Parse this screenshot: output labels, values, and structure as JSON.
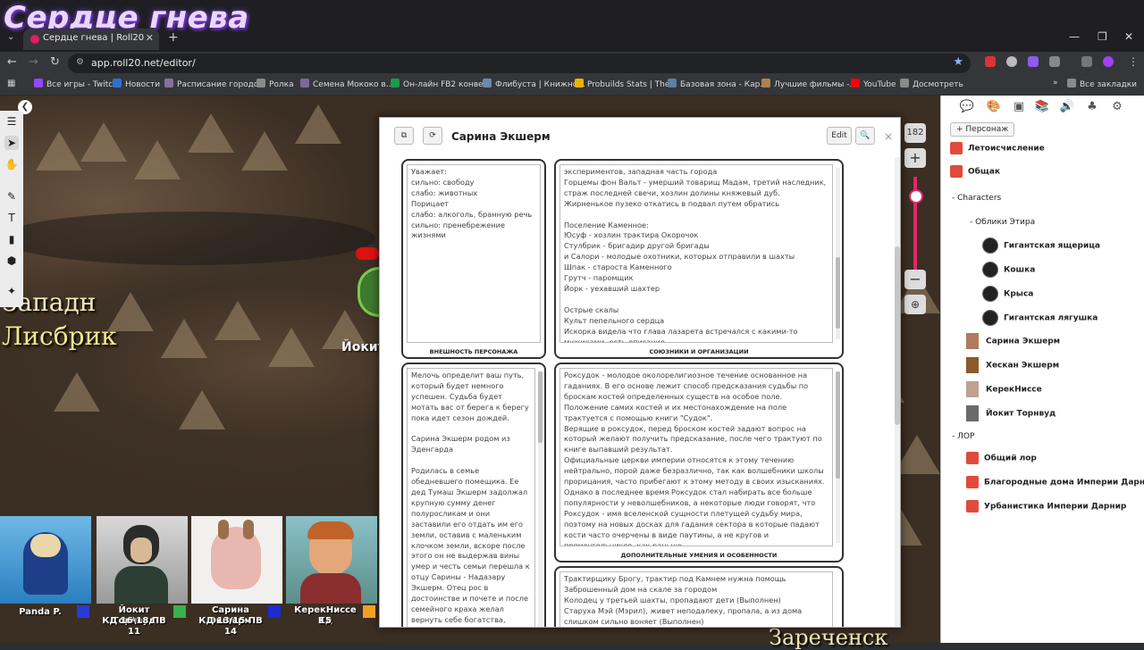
{
  "stream_title": "Сердце гнева",
  "browser": {
    "tab_title": "Сердце гнева | Roll20",
    "url": "app.roll20.net/editor/",
    "bookmarks": [
      "Все игры - Twitch",
      "Новости",
      "Расписание городс...",
      "Ролка",
      "Семена Мококо в...",
      "Он-лайн FB2 конве...",
      "Флибуста | Книжно...",
      "Probuilds Stats | The...",
      "Базовая зона - Кар...",
      "Лучшие фильмы -...",
      "YouTube",
      "Досмотреть"
    ],
    "all_bookmarks": "Все закладки",
    "more": "»"
  },
  "map": {
    "labels": [
      "Западн",
      "Лисбрик",
      "Йокит",
      "Зареченск"
    ]
  },
  "zoom": {
    "value": "182",
    "plus": "+",
    "minus": "−"
  },
  "dialog": {
    "title": "Сарина Экшерм",
    "edit": "Edit",
    "close": "×",
    "boxes": {
      "appearance": {
        "caption": "ВНЕШНОСТЬ ПЕРСОНАЖА",
        "text": "Уважает:\nсильно: свободу\nслабо: животных\nПорицает\nслабо: алкоголь, бранную речь\nсильно: пренебрежение жизнями"
      },
      "allies": {
        "caption": "СОЮЗНИКИ И ОРГАНИЗАЦИИ",
        "text": "экспериментов, западная часть города\nГорцемы фон Вальт - умерший товарищ Мадам, третий наследник, страж последней свечи, хозлин долины княжевый дуб.\nЖирненькое пузеко откатись в подвал путем обратись\n\nПоселение Каменное:\nЮсуф - хозлин трактира Окорочок\nСтулбрик - бригадир другой бригады\n и Салори - молодые охотники, которых отправили в шахты\nШпак - староста Каменного\nГрутч - паромщик\nЙорк - уехавший шахтер\n\nОстрые скалы\nКульт пепельного сердца\nИскорка видела что глава лазарета встречался с какими-то мужиками, есть описание."
      },
      "backstory": {
        "text": "Мелочь определит ваш путь, который будет немного успешен. Судьба будет мотать вас от берега к берегу пока идет сезон дождей.\n\nСарина Экшерм родом из Эденгарда\n\nРодилась в семье обедневшего помещика. Ее дед Тумаш Экшерм задолжал крупную сумму денег полуросликам и они заставили его отдать им его земли, оставив с маленьким клочком земли, вскоре после этого он не выдержав вины умер и честь семьи перешла к отцу Сарины - Надазару Экшерм. Отец рос в достоинстве и почете и после семейного краха желал вернуть себе богатства, однако имея лишь жалкий клочок земли да избу на опушке многого не"
      },
      "features": {
        "caption": "ДОПОЛНИТЕЛЬНЫЕ УМЕНИЯ И ОСОБЕННОСТИ",
        "text": "Роксудок - молодое околорелигиозное течение основанное на гаданиях. В его основе лежит способ предсказания судьбы по броскам костей определенных существ на особое поле. Положение самих костей и их местонахождение на поле трактуется с помощью книги \"Судок\".\nВерящие в роксудок, перед броском костей задают вопрос на который желают получить предсказание, после чего трактуют по книге выпавший результат.\nОфициальные церкви империи относятся к этому течению нейтрально, порой даже безразлично, так как волшебники школы прорицания, часто прибегают к этому методу в своих изысканиях. Однако в последнее время Роксудок стал набирать все больше популярности у неволшебников, а некоторые люди говорят, что Роксудок - имя вселенской сущности плетущей судьбу мира, поэтому на новых досках для гадания сектора в которые падают кости часто очерчены в виде паутины, а не кругов и прямоугольников, как раньше.\nКости животных трясут в руках сложенных подочкой на доской, в этот момент гадающий задает вопрос о жгущей его судьбе в определенных"
      },
      "quests": {
        "text": "Трактирщику Брогу, трактир под Камнем нужна помощь\nЗаброшенный дом на скале за городом\nКолодец у третьей шахты, пропадают дети (Выполнен)\nСтаруха Мэй (Мэрил), живет неподалеку, пропала, а из дома слишком сильно воняет (Выполнен)"
      }
    }
  },
  "sidebar": {
    "add_character": "+ Персонаж",
    "handouts_top": [
      "Летоисчисление",
      "Общак"
    ],
    "folder_characters": "Characters",
    "folder_forms": "Облики Этира",
    "forms": [
      "Гигантская ящерица",
      "Кошка",
      "Крыса",
      "Гигантская лягушка"
    ],
    "characters": [
      "Сарина Экшерм",
      "Хескан Экшерм",
      "КерекНиссе",
      "Йокит Торнвуд"
    ],
    "folder_lore": "ЛОР",
    "lore": [
      "Общий лор",
      "Благородные дома Империи Дарнир",
      "Урбанистика Империи Дарнир"
    ]
  },
  "players": [
    {
      "name": "Panda P.",
      "stats": "",
      "color": "#2a3ad6"
    },
    {
      "name": "Йокит Торнвуд",
      "stats": "КД 16\\18 ПВ 11",
      "color": "#39b04a"
    },
    {
      "name": "Сарина Экшерм",
      "stats": "КД 13/15 ПВ 14",
      "color": "#1d2ad0"
    },
    {
      "name": "КерекНиссе Кд",
      "stats": "15",
      "color": "#f0a020"
    }
  ],
  "colors": {
    "accent": "#e0266a",
    "roll20_red": "#e04a3b"
  }
}
